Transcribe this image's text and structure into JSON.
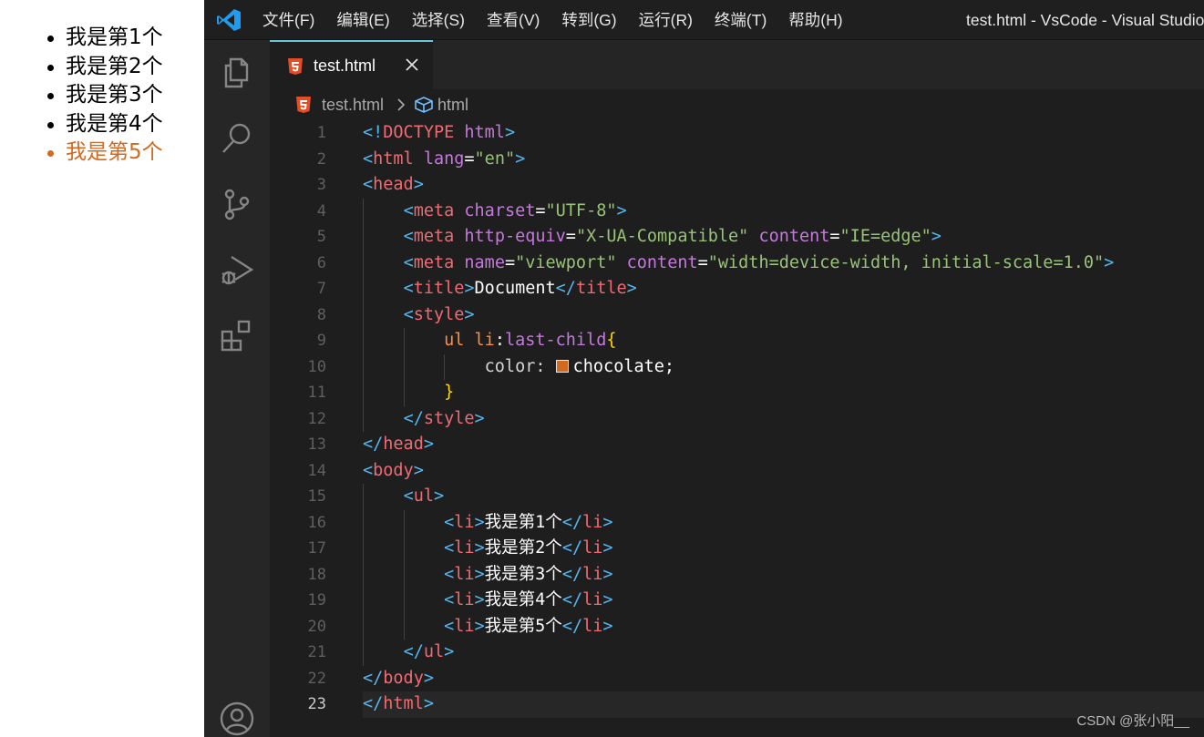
{
  "preview": {
    "items": [
      "我是第1个",
      "我是第2个",
      "我是第3个",
      "我是第4个",
      "我是第5个"
    ],
    "last_child_color": "#d2691e"
  },
  "titlebar": {
    "menu": [
      "文件(F)",
      "编辑(E)",
      "选择(S)",
      "查看(V)",
      "转到(G)",
      "运行(R)",
      "终端(T)",
      "帮助(H)"
    ],
    "window_title": "test.html - VsCode - Visual Studio"
  },
  "activity_bar": {
    "icons": [
      "explorer-icon",
      "search-icon",
      "source-control-icon",
      "run-debug-icon",
      "extensions-icon",
      "account-icon"
    ]
  },
  "tab": {
    "filename": "test.html",
    "icon": "html5-icon",
    "close_icon": "close-icon"
  },
  "breadcrumb": {
    "file": "test.html",
    "symbol": "html"
  },
  "editor": {
    "current_line": 23,
    "line_numbers": [
      "1",
      "2",
      "3",
      "4",
      "5",
      "6",
      "7",
      "8",
      "9",
      "10",
      "11",
      "12",
      "13",
      "14",
      "15",
      "16",
      "17",
      "18",
      "19",
      "20",
      "21",
      "22",
      "23"
    ],
    "swatch_color": "#d2691e",
    "lines": [
      [
        "<!",
        "DOCTYPE",
        " ",
        "html",
        ">"
      ],
      [
        "<",
        "html",
        " ",
        "lang",
        "=",
        "\"en\"",
        ">"
      ],
      [
        "<",
        "head",
        ">"
      ],
      [
        "    ",
        "<",
        "meta",
        " ",
        "charset",
        "=",
        "\"UTF-8\"",
        ">"
      ],
      [
        "    ",
        "<",
        "meta",
        " ",
        "http-equiv",
        "=",
        "\"X-UA-Compatible\"",
        " ",
        "content",
        "=",
        "\"IE=edge\"",
        ">"
      ],
      [
        "    ",
        "<",
        "meta",
        " ",
        "name",
        "=",
        "\"viewport\"",
        " ",
        "content",
        "=",
        "\"width=device-width, initial-scale=1.0\"",
        ">"
      ],
      [
        "    ",
        "<",
        "title",
        ">",
        "Document",
        "</",
        "title",
        ">"
      ],
      [
        "    ",
        "<",
        "style",
        ">"
      ],
      [
        "        ",
        "ul li",
        ":",
        "last-child",
        "{"
      ],
      [
        "            ",
        "color",
        ": ",
        "chocolate",
        ";"
      ],
      [
        "        ",
        "}"
      ],
      [
        "    ",
        "</",
        "style",
        ">"
      ],
      [
        "</",
        "head",
        ">"
      ],
      [
        "<",
        "body",
        ">"
      ],
      [
        "    ",
        "<",
        "ul",
        ">"
      ],
      [
        "        ",
        "<",
        "li",
        ">",
        "我是第1个",
        "</",
        "li",
        ">"
      ],
      [
        "        ",
        "<",
        "li",
        ">",
        "我是第2个",
        "</",
        "li",
        ">"
      ],
      [
        "        ",
        "<",
        "li",
        ">",
        "我是第3个",
        "</",
        "li",
        ">"
      ],
      [
        "        ",
        "<",
        "li",
        ">",
        "我是第4个",
        "</",
        "li",
        ">"
      ],
      [
        "        ",
        "<",
        "li",
        ">",
        "我是第5个",
        "</",
        "li",
        ">"
      ],
      [
        "    ",
        "</",
        "ul",
        ">"
      ],
      [
        "</",
        "body",
        ">"
      ],
      [
        "</",
        "html",
        ">"
      ]
    ]
  },
  "watermark": "CSDN @张小阳__"
}
